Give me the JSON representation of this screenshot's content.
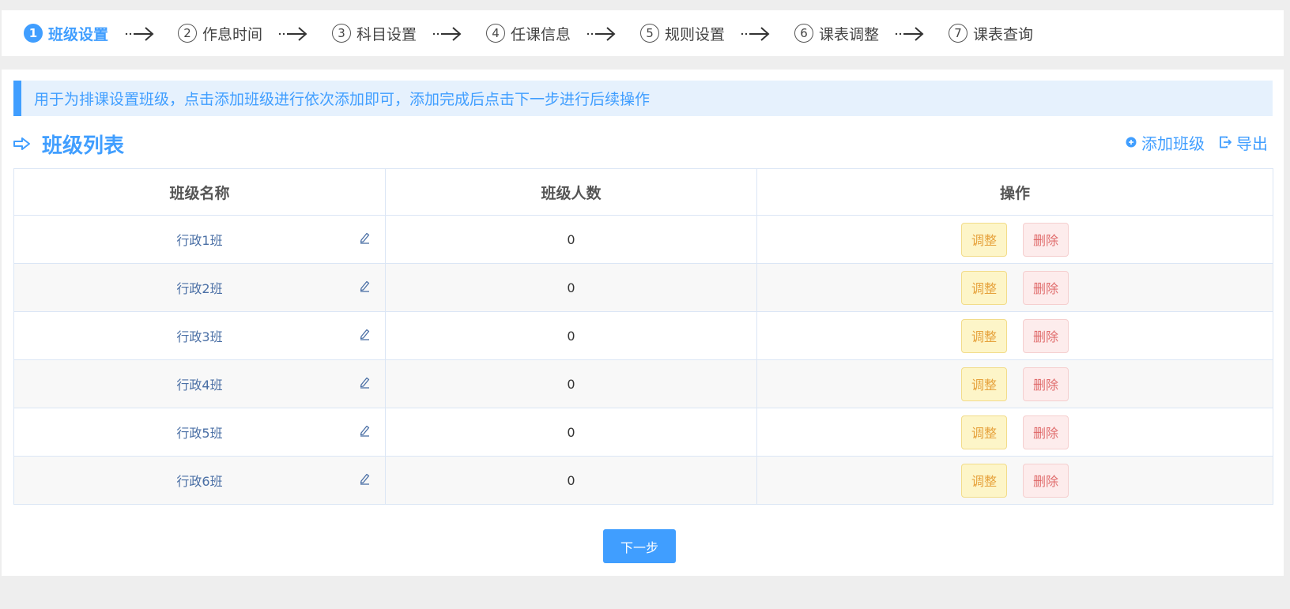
{
  "steps": [
    {
      "num": "1",
      "label": "班级设置",
      "active": true
    },
    {
      "num": "2",
      "label": "作息时间",
      "active": false
    },
    {
      "num": "3",
      "label": "科目设置",
      "active": false
    },
    {
      "num": "4",
      "label": "任课信息",
      "active": false
    },
    {
      "num": "5",
      "label": "规则设置",
      "active": false
    },
    {
      "num": "6",
      "label": "课表调整",
      "active": false
    },
    {
      "num": "7",
      "label": "课表查询",
      "active": false
    }
  ],
  "tip": "用于为排课设置班级，点击添加班级进行依次添加即可，添加完成后点击下一步进行后续操作",
  "list": {
    "title": "班级列表",
    "add_label": "添加班级",
    "export_label": "导出"
  },
  "table": {
    "headers": [
      "班级名称",
      "班级人数",
      "操作"
    ],
    "rows": [
      {
        "name": "行政1班",
        "count": "0"
      },
      {
        "name": "行政2班",
        "count": "0"
      },
      {
        "name": "行政3班",
        "count": "0"
      },
      {
        "name": "行政4班",
        "count": "0"
      },
      {
        "name": "行政5班",
        "count": "0"
      },
      {
        "name": "行政6班",
        "count": "0"
      }
    ],
    "adjust_label": "调整",
    "delete_label": "删除"
  },
  "next_label": "下一步",
  "colors": {
    "accent": "#409eff",
    "adjust": "#e6a23c",
    "delete": "#e06c6c"
  }
}
